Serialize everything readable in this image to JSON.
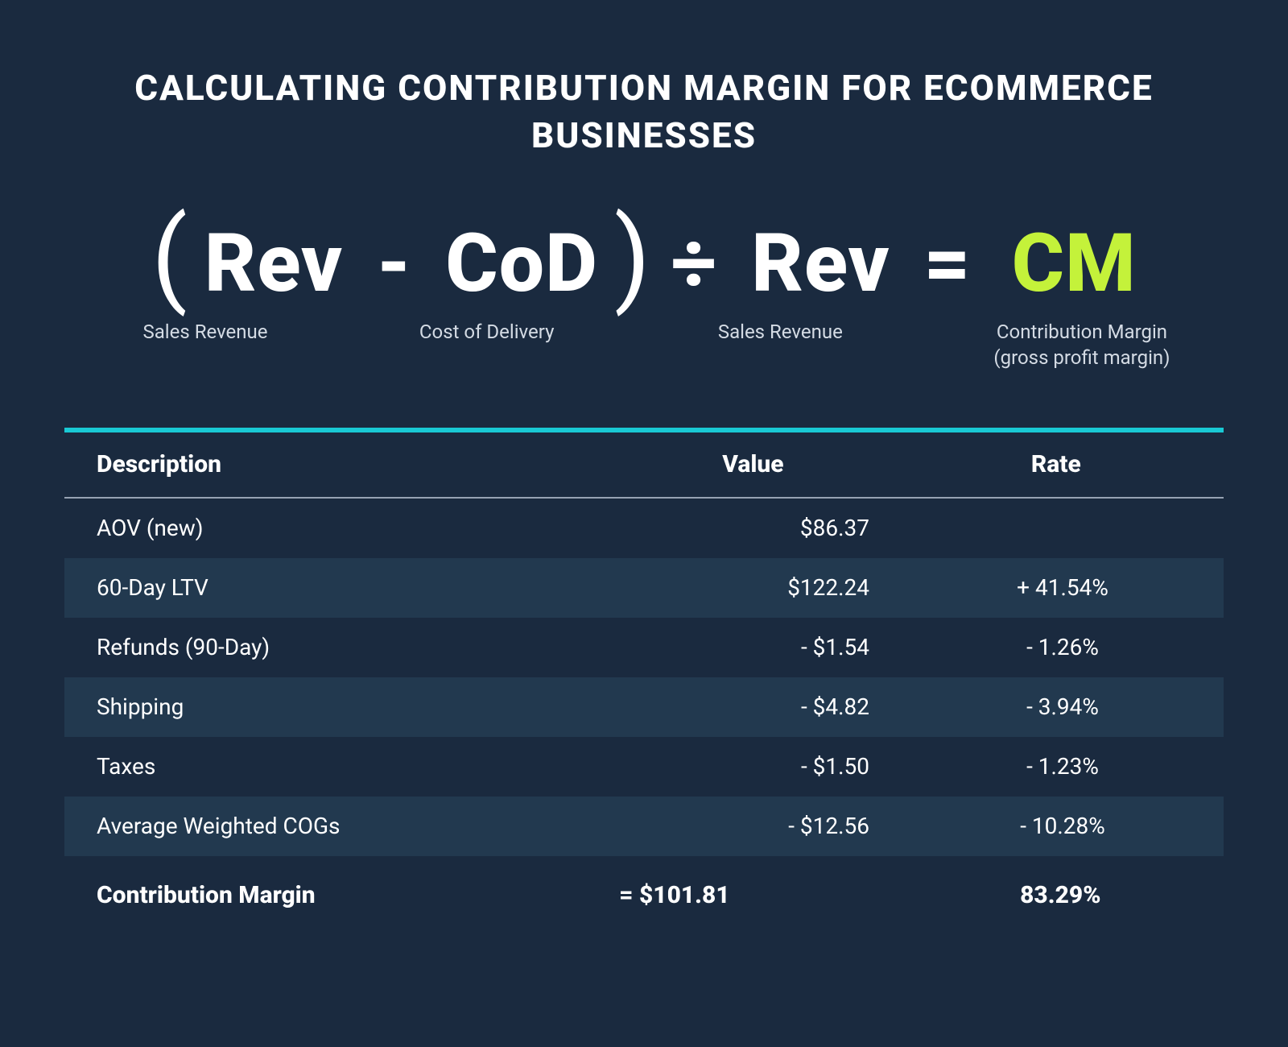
{
  "title": "CALCULATING CONTRIBUTION MARGIN FOR ECOMMERCE BUSINESSES",
  "formula": {
    "lp": "(",
    "rev1": "Rev",
    "minus": "-",
    "cod": "CoD",
    "rp": ")",
    "div": "÷",
    "rev2": "Rev",
    "eq": "=",
    "cm": "CM"
  },
  "sub": {
    "rev1": "Sales Revenue",
    "cod": "Cost of Delivery",
    "rev2": "Sales Revenue",
    "cm_line1": "Contribution Margin",
    "cm_line2": "(gross profit margin)"
  },
  "cols": {
    "desc": "Description",
    "value": "Value",
    "rate": "Rate"
  },
  "rows": [
    {
      "desc": "AOV (new)",
      "value": "$86.37",
      "rate": ""
    },
    {
      "desc": "60-Day LTV",
      "value": "$122.24",
      "rate": "+ 41.54%"
    },
    {
      "desc": "Refunds (90-Day)",
      "value": "- $1.54",
      "rate": "- 1.26%"
    },
    {
      "desc": "Shipping",
      "value": "- $4.82",
      "rate": "- 3.94%"
    },
    {
      "desc": "Taxes",
      "value": "- $1.50",
      "rate": "- 1.23%"
    },
    {
      "desc": "Average Weighted COGs",
      "value": "- $12.56",
      "rate": "- 10.28%"
    }
  ],
  "footer": {
    "desc": "Contribution Margin",
    "value": "=  $101.81",
    "rate": "83.29%"
  },
  "chart_data": {
    "type": "table",
    "title": "Calculating Contribution Margin for Ecommerce Businesses",
    "formula": "(Rev - CoD) ÷ Rev = CM",
    "definitions": {
      "Rev": "Sales Revenue",
      "CoD": "Cost of Delivery",
      "CM": "Contribution Margin (gross profit margin)"
    },
    "columns": [
      "Description",
      "Value",
      "Rate"
    ],
    "data": [
      {
        "Description": "AOV (new)",
        "Value": 86.37,
        "Rate": null
      },
      {
        "Description": "60-Day LTV",
        "Value": 122.24,
        "Rate": 41.54
      },
      {
        "Description": "Refunds (90-Day)",
        "Value": -1.54,
        "Rate": -1.26
      },
      {
        "Description": "Shipping",
        "Value": -4.82,
        "Rate": -3.94
      },
      {
        "Description": "Taxes",
        "Value": -1.5,
        "Rate": -1.23
      },
      {
        "Description": "Average Weighted COGs",
        "Value": -12.56,
        "Rate": -10.28
      }
    ],
    "result": {
      "Description": "Contribution Margin",
      "Value": 101.81,
      "Rate": 83.29
    }
  }
}
